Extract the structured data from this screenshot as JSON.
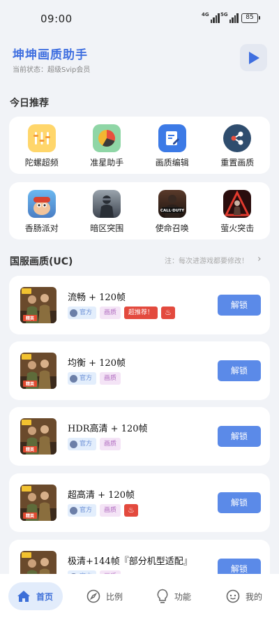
{
  "status_bar": {
    "time": "09:00",
    "network1": "4G",
    "network2": "5G",
    "battery": "85"
  },
  "header": {
    "title": "坤坤画质助手",
    "status": "当前状态：超级Svip会员"
  },
  "sections": {
    "today": "今日推荐",
    "uc": "国服画质(UC)",
    "uc_note": "注：每次进游戏都要修改！"
  },
  "tools": [
    {
      "label": "陀螺超频",
      "icon": "gyroscope-icon",
      "color": "#ffd66b"
    },
    {
      "label": "准星助手",
      "icon": "crosshair-pie-icon",
      "color": "#8fd6a6"
    },
    {
      "label": "画质编辑",
      "icon": "edit-document-icon",
      "color": "#3c7ae6"
    },
    {
      "label": "重置画质",
      "icon": "share-reset-icon",
      "color": "#2f4d6e"
    }
  ],
  "games": [
    {
      "label": "香肠派对",
      "icon": "sausage-party-icon"
    },
    {
      "label": "暗区突围",
      "icon": "arena-breakout-icon"
    },
    {
      "label": "使命召唤",
      "icon": "call-of-duty-icon"
    },
    {
      "label": "萤火突击",
      "icon": "firefly-assault-icon"
    }
  ],
  "presets": [
    {
      "name": "流畅 + 120帧",
      "tags": [
        "官方",
        "画质"
      ],
      "hot_label": "超推荐！",
      "fire": true
    },
    {
      "name": "均衡 + 120帧",
      "tags": [
        "官方",
        "画质"
      ],
      "hot_label": "",
      "fire": false
    },
    {
      "name": "HDR高清 + 120帧",
      "tags": [
        "官方",
        "画质"
      ],
      "hot_label": "",
      "fire": false
    },
    {
      "name": "超高清 + 120帧",
      "tags": [
        "官方",
        "画质"
      ],
      "hot_label": "",
      "fire": true
    },
    {
      "name": "极清+144帧『部分机型适配』",
      "tags": [
        "官方",
        "画质"
      ],
      "hot_label": "",
      "fire": false
    }
  ],
  "unlock_label": "解锁",
  "tabbar": [
    {
      "label": "首页",
      "icon": "home-icon"
    },
    {
      "label": "比例",
      "icon": "compass-icon"
    },
    {
      "label": "功能",
      "icon": "bulb-icon"
    },
    {
      "label": "我的",
      "icon": "profile-icon"
    }
  ]
}
